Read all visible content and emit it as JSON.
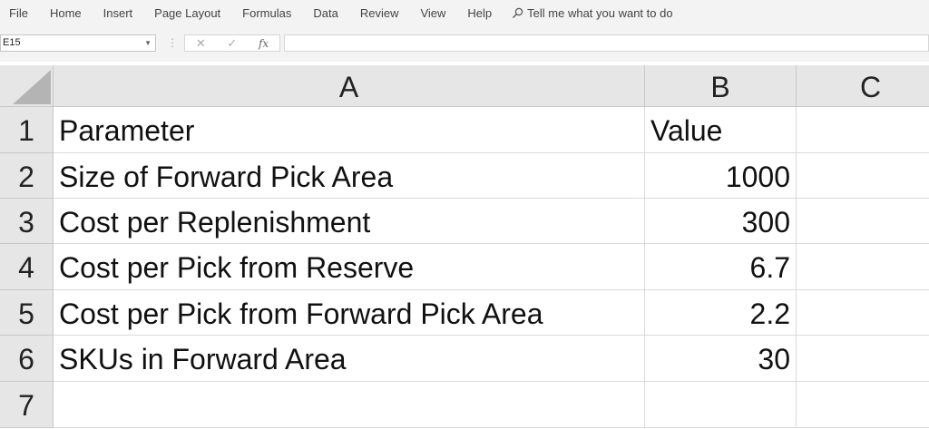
{
  "ribbon": {
    "tabs": [
      "File",
      "Home",
      "Insert",
      "Page Layout",
      "Formulas",
      "Data",
      "Review",
      "View",
      "Help"
    ],
    "tell_me": "Tell me what you want to do"
  },
  "formula_bar": {
    "name_box": "E15",
    "formula": ""
  },
  "sheet": {
    "columns": [
      "A",
      "B",
      "C"
    ],
    "rows": [
      "1",
      "2",
      "3",
      "4",
      "5",
      "6",
      "7"
    ],
    "cells": [
      [
        "Parameter",
        "Value",
        ""
      ],
      [
        "Size of Forward Pick Area",
        "1000",
        ""
      ],
      [
        "Cost per Replenishment",
        "300",
        ""
      ],
      [
        "Cost per Pick from Reserve",
        "6.7",
        ""
      ],
      [
        "Cost per Pick from Forward Pick Area",
        "2.2",
        ""
      ],
      [
        "SKUs in Forward Area",
        "30",
        ""
      ],
      [
        "",
        "",
        ""
      ]
    ]
  }
}
